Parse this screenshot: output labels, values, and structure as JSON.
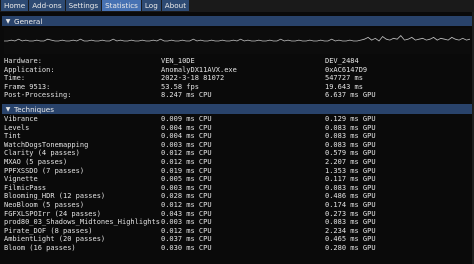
{
  "tabs": [
    "Home",
    "Add-ons",
    "Settings",
    "Statistics",
    "Log",
    "About"
  ],
  "active_tab": "Statistics",
  "general": {
    "title": "General",
    "rows": [
      {
        "label": "Hardware:",
        "a": "VEN_10DE",
        "b": "DEV_2484"
      },
      {
        "label": "Application:",
        "a": "AnomalyDX11AVX.exe",
        "b": "0xAC6147D9"
      },
      {
        "label": "Time:",
        "a": "2022-3-18 81072",
        "b": "547727 ms"
      },
      {
        "label": "Frame 9513:",
        "a": "53.58 fps",
        "b": "19.643 ms"
      },
      {
        "label": "Post-Processing:",
        "a": "8.247 ms CPU",
        "b": "6.637 ms GPU"
      }
    ]
  },
  "techniques": {
    "title": "Techniques",
    "rows": [
      {
        "name": "Vibrance",
        "cpu": "0.009 ms CPU",
        "gpu": "0.129 ms GPU"
      },
      {
        "name": "Levels",
        "cpu": "0.004 ms CPU",
        "gpu": "0.083 ms GPU"
      },
      {
        "name": "Tint",
        "cpu": "0.004 ms CPU",
        "gpu": "0.083 ms GPU"
      },
      {
        "name": "WatchDogsTonemapping",
        "cpu": "0.003 ms CPU",
        "gpu": "0.083 ms GPU"
      },
      {
        "name": "Clarity (4 passes)",
        "cpu": "0.012 ms CPU",
        "gpu": "0.579 ms GPU"
      },
      {
        "name": "MXAO (5 passes)",
        "cpu": "0.012 ms CPU",
        "gpu": "2.207 ms GPU"
      },
      {
        "name": "PPFXSSDO (7 passes)",
        "cpu": "0.019 ms CPU",
        "gpu": "1.353 ms GPU"
      },
      {
        "name": "Vignette",
        "cpu": "0.005 ms CPU",
        "gpu": "0.117 ms GPU"
      },
      {
        "name": "FilmicPass",
        "cpu": "0.003 ms CPU",
        "gpu": "0.083 ms GPU"
      },
      {
        "name": "Blooming_HDR (12 passes)",
        "cpu": "0.028 ms CPU",
        "gpu": "0.486 ms GPU"
      },
      {
        "name": "NeoBloom (5 passes)",
        "cpu": "0.012 ms CPU",
        "gpu": "0.174 ms GPU"
      },
      {
        "name": "FGFXLSPOIrr (24 passes)",
        "cpu": "0.043 ms CPU",
        "gpu": "0.273 ms GPU"
      },
      {
        "name": "prod80_03_Shadows_Midtones_Highlights",
        "cpu": "0.003 ms CPU",
        "gpu": "0.083 ms GPU"
      },
      {
        "name": "Pirate_DOF (8 passes)",
        "cpu": "0.012 ms CPU",
        "gpu": "2.234 ms GPU"
      },
      {
        "name": "AmbientLight (20 passes)",
        "cpu": "0.037 ms CPU",
        "gpu": "0.465 ms GPU"
      },
      {
        "name": "Bloom (16 passes)",
        "cpu": "0.030 ms CPU",
        "gpu": "0.280 ms GPU"
      }
    ]
  },
  "graph": {
    "frame_times": [
      10,
      10,
      11,
      10,
      12,
      10,
      11,
      10,
      10,
      11,
      10,
      10,
      12,
      11,
      10,
      10,
      11,
      10,
      10,
      11,
      10,
      12,
      10,
      10,
      11,
      10,
      10,
      11,
      10,
      10,
      12,
      10,
      11,
      10,
      10,
      11,
      10,
      10,
      11,
      10,
      10,
      11,
      10,
      12,
      10,
      10,
      11,
      10,
      10,
      11,
      10,
      10,
      12,
      10,
      11,
      10,
      10,
      11,
      10,
      10,
      11,
      10,
      10,
      11,
      10,
      12,
      10,
      11,
      10,
      10,
      11,
      10,
      10,
      11,
      10,
      10,
      12,
      10,
      11,
      10,
      10,
      11,
      10,
      10,
      11,
      10,
      10,
      11,
      10,
      10,
      12,
      10,
      11,
      10,
      10,
      11,
      10,
      10,
      11,
      12,
      14,
      11,
      13,
      10,
      15,
      12,
      11,
      13,
      12,
      16,
      11,
      12,
      14,
      11,
      12,
      13,
      11,
      12,
      14,
      11,
      13,
      12,
      11,
      14,
      12,
      11,
      13,
      11,
      12
    ],
    "color": "#bdbdbd"
  },
  "colors": {
    "tab": "#2d4a73",
    "tab_active": "#4772b3",
    "header": "#29436b",
    "background": "#0a0a0a"
  }
}
